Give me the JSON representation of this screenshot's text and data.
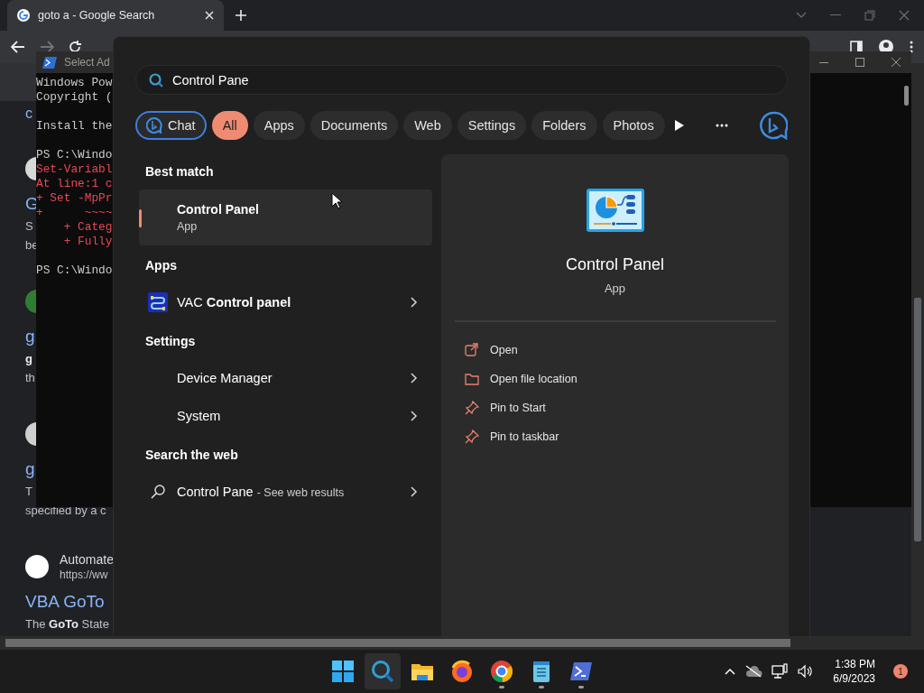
{
  "browser": {
    "tab": {
      "title": "goto a - Google Search"
    },
    "top_link": "c",
    "results": [
      {
        "color": "#d8d8d8",
        "title": "G",
        "snippet": [
          "S",
          "be"
        ]
      },
      {
        "color": "#2e7d32",
        "title": "g",
        "snippet": [
          "**g**",
          "th"
        ]
      },
      {
        "color": "#cfcfcf",
        "title": "g",
        "snippet": [
          "T",
          "specified by a c"
        ]
      },
      {
        "color": "#ffffff",
        "site": "Automate",
        "url": "https://ww",
        "title": "VBA GoTo",
        "snippet": [
          "The **GoTo** State"
        ]
      }
    ]
  },
  "terminal": {
    "title": "Select Ad",
    "blocks": [
      {
        "lines": [
          {
            "text": "Windows Pow",
            "kind": "output"
          },
          {
            "text": "Copyright (",
            "kind": "output"
          }
        ]
      },
      {
        "lines": [
          {
            "text": "Install the",
            "kind": "output"
          }
        ]
      },
      {
        "lines": [
          {
            "text": "PS C:\\Windo",
            "kind": "output"
          },
          {
            "text": "Set-Variabl",
            "kind": "error"
          },
          {
            "text": "At line:1 c",
            "kind": "error"
          },
          {
            "text": "+ Set -MpPr",
            "kind": "error"
          },
          {
            "text": "+      ~~~~",
            "kind": "error"
          },
          {
            "text": "    + Categ",
            "kind": "error"
          },
          {
            "text": "    + Fully",
            "kind": "error"
          }
        ]
      },
      {
        "lines": [
          {
            "text": "PS C:\\Windo",
            "kind": "output"
          }
        ]
      }
    ]
  },
  "search": {
    "query": "Control Pane",
    "filters": [
      {
        "label": "Chat",
        "kind": "chat",
        "selected": false
      },
      {
        "label": "All",
        "kind": "filter",
        "selected": true
      },
      {
        "label": "Apps",
        "kind": "filter",
        "selected": false
      },
      {
        "label": "Documents",
        "kind": "filter",
        "selected": false
      },
      {
        "label": "Web",
        "kind": "filter",
        "selected": false
      },
      {
        "label": "Settings",
        "kind": "filter",
        "selected": false
      },
      {
        "label": "Folders",
        "kind": "filter",
        "selected": false
      },
      {
        "label": "Photos",
        "kind": "filter",
        "selected": false
      }
    ],
    "sections": [
      {
        "heading": "Best match",
        "items": [
          {
            "kind": "best",
            "title": "Control Panel",
            "subtitle": "App",
            "selected": true
          }
        ]
      },
      {
        "heading": "Apps",
        "items": [
          {
            "kind": "app",
            "title": "VAC **Control panel**",
            "selected": false
          }
        ]
      },
      {
        "heading": "Settings",
        "items": [
          {
            "kind": "setting",
            "title": "Device Manager",
            "selected": false
          },
          {
            "kind": "setting",
            "title": "System",
            "selected": false
          }
        ]
      },
      {
        "heading": "Search the web",
        "items": [
          {
            "kind": "web",
            "title": "Control Pane",
            "hint": "- See web results",
            "selected": false
          }
        ]
      }
    ],
    "preview": {
      "title": "Control Panel",
      "subtitle": "App",
      "actions": [
        {
          "kind": "open",
          "label": "Open"
        },
        {
          "kind": "folder",
          "label": "Open file location"
        },
        {
          "kind": "pin",
          "label": "Pin to Start"
        },
        {
          "kind": "pin",
          "label": "Pin to taskbar"
        }
      ]
    }
  },
  "taskbar": {
    "apps": [
      {
        "kind": "start",
        "selected": false,
        "running": false
      },
      {
        "kind": "search",
        "selected": true,
        "running": false
      },
      {
        "kind": "explorer",
        "selected": false,
        "running": false
      },
      {
        "kind": "firefox",
        "selected": false,
        "running": false
      },
      {
        "kind": "chrome",
        "selected": false,
        "running": true
      },
      {
        "kind": "notepad",
        "selected": false,
        "running": true
      },
      {
        "kind": "powershell",
        "selected": false,
        "running": true
      }
    ],
    "time": "1:38 PM",
    "date": "6/9/2023",
    "notifications": "1"
  }
}
